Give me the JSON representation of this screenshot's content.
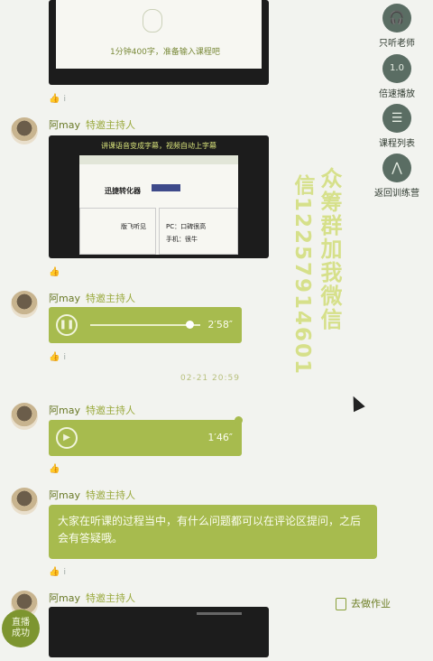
{
  "top_card": {
    "text": "1分钟400字，准备输入课程吧"
  },
  "posts": [
    {
      "author": "阿may",
      "role": "特邀主持人"
    },
    {
      "author": "阿may",
      "role": "特邀主持人"
    },
    {
      "author": "阿may",
      "role": "特邀主持人"
    },
    {
      "author": "阿may",
      "role": "特邀主持人"
    },
    {
      "author": "阿may",
      "role": "特邀主持人"
    }
  ],
  "slide1": {
    "title": "讲课语音变成字幕，视频自动上字幕",
    "button_text": "迅捷转化器",
    "left_caption": "版飞听见",
    "right_caption1": "PC：口碑很高",
    "right_caption2": "手机：很牛"
  },
  "audio1": {
    "duration": "2′58″",
    "progress": 0.9
  },
  "audio2": {
    "duration": "1′46″",
    "progress": 0.0
  },
  "timestamp": "02-21 20:59",
  "message": {
    "text": "大家在听课的过程当中，有什么问题都可以在评论区提问，之后会有答疑哦。"
  },
  "watermark": {
    "line1": "众筹群加我微信",
    "line2": "信12257914601"
  },
  "sidebar": [
    {
      "label": "只听老师",
      "icon": "headphones-icon",
      "glyph": "🎧"
    },
    {
      "label": "倍速播放",
      "icon": "speed-icon",
      "glyph": "1.0"
    },
    {
      "label": "课程列表",
      "icon": "list-icon",
      "glyph": "☰"
    },
    {
      "label": "返回训练营",
      "icon": "return-icon",
      "glyph": "⋀"
    }
  ],
  "homework": {
    "label": "去做作业"
  },
  "live_badge": {
    "line1": "直播",
    "line2": "成功"
  }
}
